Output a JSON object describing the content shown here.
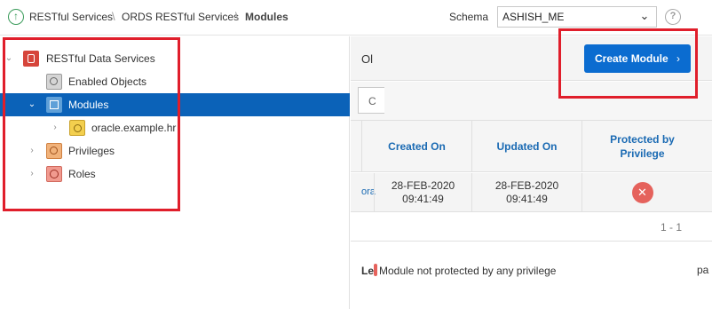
{
  "breadcrumb": {
    "items": [
      "RESTful Services",
      "ORDS RESTful Services",
      "Modules"
    ]
  },
  "schema": {
    "label": "Schema",
    "value": "ASHISH_ME",
    "help": "?"
  },
  "tree": {
    "nodes": [
      {
        "label": "RESTful Data Services",
        "icon": "rest-service-icon",
        "expanded": true,
        "selected": false
      },
      {
        "label": "Enabled Objects",
        "icon": "enabled-objects-icon",
        "expanded": false,
        "selected": false
      },
      {
        "label": "Modules",
        "icon": "modules-icon",
        "expanded": true,
        "selected": true
      },
      {
        "label": "oracle.example.hr",
        "icon": "template-icon",
        "expanded": false,
        "selected": false
      },
      {
        "label": "Privileges",
        "icon": "privileges-icon",
        "expanded": false,
        "selected": false
      },
      {
        "label": "Roles",
        "icon": "roles-icon",
        "expanded": false,
        "selected": false
      }
    ]
  },
  "panel": {
    "title": "Ol",
    "create_button": "Create Module",
    "search_stub": "C"
  },
  "grid": {
    "columns": [
      "Created On",
      "Updated On",
      "Protected by Privilege"
    ],
    "rows": [
      {
        "link": "ora",
        "created": "28-FEB-2020 09:41:49",
        "updated": "28-FEB-2020 09:41:49",
        "protected": "✕"
      }
    ],
    "pagination": "1 - 1"
  },
  "legend": {
    "key": "Le",
    "text": "Module not protected by any privilege",
    "tail": "pa"
  },
  "colors": {
    "selected": "#0b62b8",
    "button": "#0b6cd0",
    "annotation": "#e01e2b",
    "not_protected": "#e5625c"
  }
}
